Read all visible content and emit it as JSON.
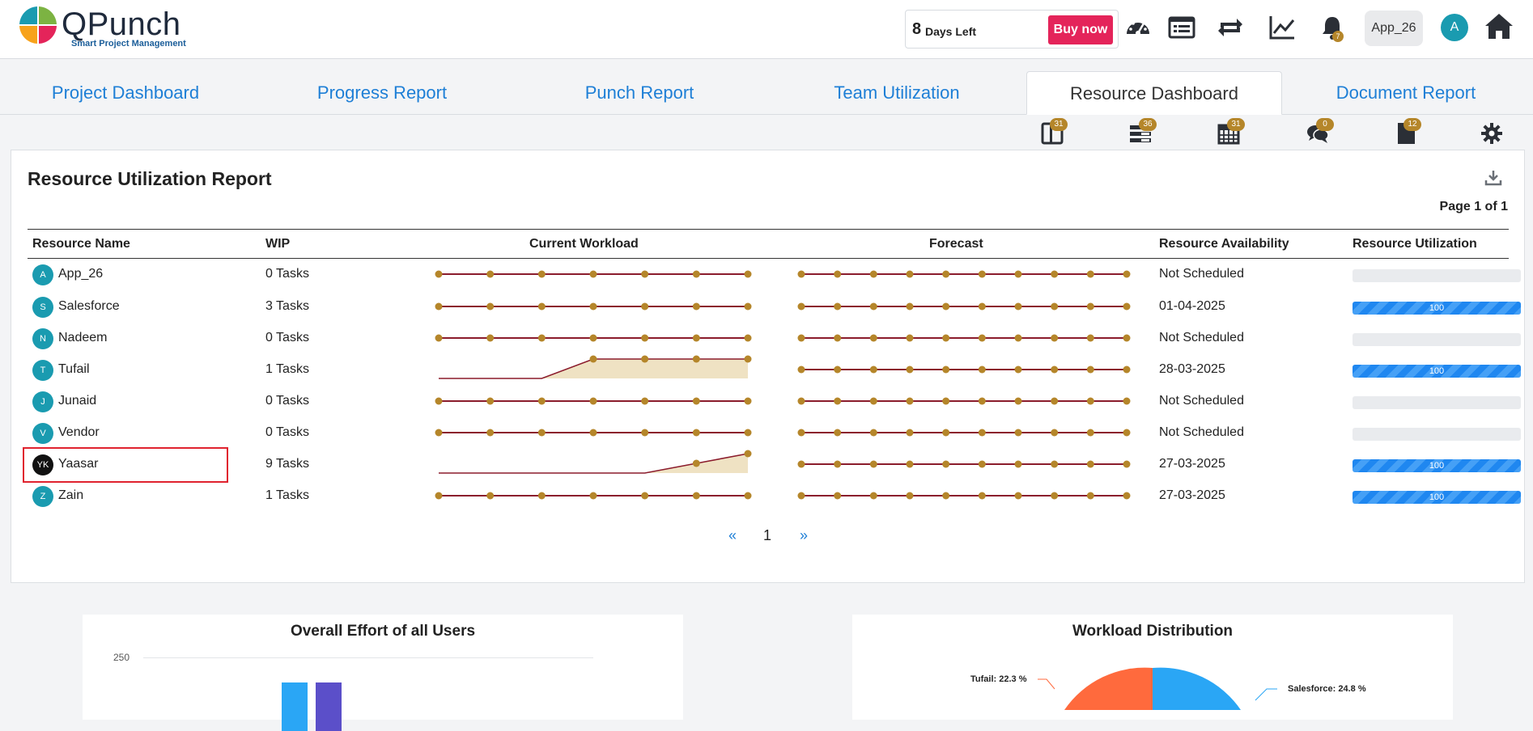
{
  "app": {
    "name": "QPunch",
    "tagline": "Smart Project Management"
  },
  "trial": {
    "days": "8",
    "label": "Days Left",
    "buy_label": "Buy now"
  },
  "header_icons": [
    "dashboard-icon",
    "list-icon",
    "sync-icon",
    "chart-line-icon",
    "bell-icon",
    "home-icon"
  ],
  "notifications": "7",
  "user": {
    "name": "App_26",
    "initial": "A"
  },
  "tabs": [
    {
      "label": "Project Dashboard",
      "active": false
    },
    {
      "label": "Progress Report",
      "active": false
    },
    {
      "label": "Punch Report",
      "active": false
    },
    {
      "label": "Team Utilization",
      "active": false
    },
    {
      "label": "Resource Dashboard",
      "active": true
    },
    {
      "label": "Document Report",
      "active": false
    }
  ],
  "toolbar_badges": [
    {
      "icon": "tablet-icon",
      "count": "31"
    },
    {
      "icon": "stack-icon",
      "count": "36"
    },
    {
      "icon": "calendar-icon",
      "count": "31"
    },
    {
      "icon": "comments-icon",
      "count": "0"
    },
    {
      "icon": "document-icon",
      "count": "12"
    }
  ],
  "report": {
    "title": "Resource Utilization Report",
    "page_info": "Page 1 of 1",
    "columns": [
      "Resource Name",
      "WIP",
      "Current Workload",
      "Forecast",
      "Resource Availability",
      "Resource Utilization"
    ],
    "rows": [
      {
        "initial": "A",
        "name": "App_26",
        "wip": "0 Tasks",
        "workload": [
          0,
          0,
          0,
          0,
          0,
          0,
          0
        ],
        "availability": "Not Scheduled",
        "utilization": null
      },
      {
        "initial": "S",
        "name": "Salesforce",
        "wip": "3 Tasks",
        "workload": [
          0,
          0,
          0,
          0,
          0,
          0,
          0
        ],
        "availability": "01-04-2025",
        "utilization": "100"
      },
      {
        "initial": "N",
        "name": "Nadeem",
        "wip": "0 Tasks",
        "workload": [
          0,
          0,
          0,
          0,
          0,
          0,
          0
        ],
        "availability": "Not Scheduled",
        "utilization": null
      },
      {
        "initial": "T",
        "name": "Tufail",
        "wip": "1 Tasks",
        "workload": [
          0,
          0,
          0,
          1,
          1,
          1,
          1
        ],
        "availability": "28-03-2025",
        "utilization": "100"
      },
      {
        "initial": "J",
        "name": "Junaid",
        "wip": "0 Tasks",
        "workload": [
          0,
          0,
          0,
          0,
          0,
          0,
          0
        ],
        "availability": "Not Scheduled",
        "utilization": null
      },
      {
        "initial": "V",
        "name": "Vendor",
        "wip": "0 Tasks",
        "workload": [
          0,
          0,
          0,
          0,
          0,
          0,
          0
        ],
        "availability": "Not Scheduled",
        "utilization": null
      },
      {
        "initial": "YK",
        "name": "Yaasar",
        "wip": "9 Tasks",
        "workload": [
          0,
          0,
          0,
          0,
          0,
          0.5,
          1
        ],
        "availability": "27-03-2025",
        "utilization": "100"
      },
      {
        "initial": "Z",
        "name": "Zain",
        "wip": "1 Tasks",
        "workload": [
          0,
          0,
          0,
          0,
          0,
          0,
          0
        ],
        "availability": "27-03-2025",
        "utilization": "100"
      }
    ],
    "pager": {
      "prev": "«",
      "current": "1",
      "next": "»"
    }
  },
  "bottom": {
    "effort_title": "Overall Effort of all Users",
    "effort_tick": "250",
    "workload_title": "Workload Distribution",
    "slices": [
      {
        "label": "Tufail: 22.3 %",
        "color": "#ff6a3d"
      },
      {
        "label": "Salesforce: 24.8 %",
        "color": "#2aa6f5"
      }
    ]
  },
  "colors": {
    "accent": "#1e7fd6",
    "buy": "#e4245a",
    "spark_line": "#8b1c2c",
    "spark_dot": "#b5862a",
    "spark_fill": "#efe2c3"
  }
}
